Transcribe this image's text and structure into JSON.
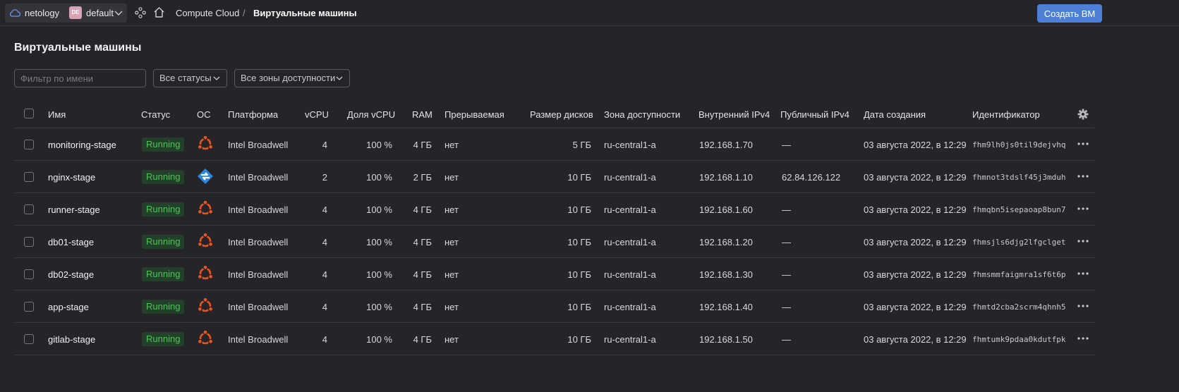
{
  "topbar": {
    "org": "netology",
    "folder_badge": "DE",
    "folder": "default",
    "breadcrumb_service": "Compute Cloud",
    "breadcrumb_separator": "/",
    "breadcrumb_page": "Виртуальные машины",
    "create_button": "Создать ВМ"
  },
  "page": {
    "title": "Виртуальные машины",
    "filter_placeholder": "Фильтр по имени",
    "status_select": "Все статусы",
    "zone_select": "Все зоны доступности"
  },
  "table": {
    "headers": {
      "name": "Имя",
      "status": "Статус",
      "os": "ОС",
      "platform": "Платформа",
      "vcpu": "vCPU",
      "vcpu_share": "Доля vCPU",
      "ram": "RAM",
      "preemptible": "Прерываемая",
      "disk_size": "Размер дисков",
      "zone": "Зона доступности",
      "internal_ip": "Внутренний IPv4",
      "public_ip": "Публичный IPv4",
      "created": "Дата создания",
      "id": "Идентификатор"
    },
    "rows": [
      {
        "name": "monitoring-stage",
        "status": "Running",
        "os": "ubuntu-icon",
        "platform": "Intel Broadwell",
        "vcpu": "4",
        "vcpu_share": "100 %",
        "ram": "4 ГБ",
        "preemptible": "нет",
        "disk": "5 ГБ",
        "zone": "ru-central1-a",
        "internal_ip": "192.168.1.70",
        "public_ip": "—",
        "created": "03 августа 2022, в 12:29",
        "id": "fhm9lh0js0til9dejvhq"
      },
      {
        "name": "nginx-stage",
        "status": "Running",
        "os": "centos-icon",
        "platform": "Intel Broadwell",
        "vcpu": "2",
        "vcpu_share": "100 %",
        "ram": "2 ГБ",
        "preemptible": "нет",
        "disk": "10 ГБ",
        "zone": "ru-central1-a",
        "internal_ip": "192.168.1.10",
        "public_ip": "62.84.126.122",
        "created": "03 августа 2022, в 12:29",
        "id": "fhmnot3tdslf45j3mduh"
      },
      {
        "name": "runner-stage",
        "status": "Running",
        "os": "ubuntu-icon",
        "platform": "Intel Broadwell",
        "vcpu": "4",
        "vcpu_share": "100 %",
        "ram": "4 ГБ",
        "preemptible": "нет",
        "disk": "10 ГБ",
        "zone": "ru-central1-a",
        "internal_ip": "192.168.1.60",
        "public_ip": "—",
        "created": "03 августа 2022, в 12:29",
        "id": "fhmqbn5isepaoap8bun7"
      },
      {
        "name": "db01-stage",
        "status": "Running",
        "os": "ubuntu-icon",
        "platform": "Intel Broadwell",
        "vcpu": "4",
        "vcpu_share": "100 %",
        "ram": "4 ГБ",
        "preemptible": "нет",
        "disk": "10 ГБ",
        "zone": "ru-central1-a",
        "internal_ip": "192.168.1.20",
        "public_ip": "—",
        "created": "03 августа 2022, в 12:29",
        "id": "fhmsjls6djg2lfgclget"
      },
      {
        "name": "db02-stage",
        "status": "Running",
        "os": "ubuntu-icon",
        "platform": "Intel Broadwell",
        "vcpu": "4",
        "vcpu_share": "100 %",
        "ram": "4 ГБ",
        "preemptible": "нет",
        "disk": "10 ГБ",
        "zone": "ru-central1-a",
        "internal_ip": "192.168.1.30",
        "public_ip": "—",
        "created": "03 августа 2022, в 12:29",
        "id": "fhmsmmfaigmra1sf6t6p"
      },
      {
        "name": "app-stage",
        "status": "Running",
        "os": "ubuntu-icon",
        "platform": "Intel Broadwell",
        "vcpu": "4",
        "vcpu_share": "100 %",
        "ram": "4 ГБ",
        "preemptible": "нет",
        "disk": "10 ГБ",
        "zone": "ru-central1-a",
        "internal_ip": "192.168.1.40",
        "public_ip": "—",
        "created": "03 августа 2022, в 12:29",
        "id": "fhmtd2cba2scrm4qhnh5"
      },
      {
        "name": "gitlab-stage",
        "status": "Running",
        "os": "ubuntu-icon",
        "platform": "Intel Broadwell",
        "vcpu": "4",
        "vcpu_share": "100 %",
        "ram": "4 ГБ",
        "preemptible": "нет",
        "disk": "10 ГБ",
        "zone": "ru-central1-a",
        "internal_ip": "192.168.1.50",
        "public_ip": "—",
        "created": "03 августа 2022, в 12:29",
        "id": "fhmtumk9pdaa0kdutfpk"
      }
    ]
  },
  "colors": {
    "background": "#252429",
    "accent": "#4e7fd6",
    "running_text": "#4fc05c",
    "running_bg": "#25402a",
    "ubuntu_orange": "#e95420",
    "centos_blue": "#2a86e0"
  }
}
